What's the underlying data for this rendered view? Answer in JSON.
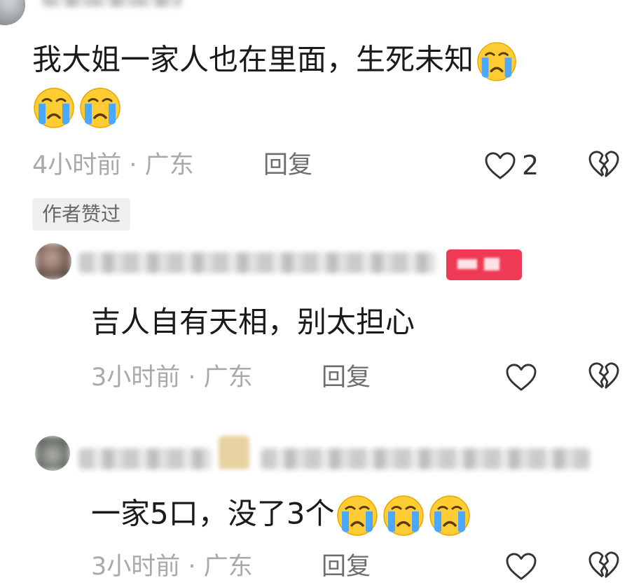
{
  "comments": [
    {
      "text": "我大姐一家人也在里面，生死未知",
      "emoji": "crying-face",
      "time": "4小时前 · 广东",
      "reply": "回复",
      "likes": "2",
      "badge": "作者赞过"
    },
    {
      "text": "吉人自有天相，别太担心",
      "time": "3小时前 · 广东",
      "reply": "回复"
    },
    {
      "text": "一家5口，没了3个",
      "emoji": "crying-face",
      "time": "3小时前 · 广东",
      "reply": "回复"
    }
  ],
  "colors": {
    "tag_red": "#ef3a55",
    "text": "#1a1a1a",
    "meta": "#a9a9a9"
  }
}
